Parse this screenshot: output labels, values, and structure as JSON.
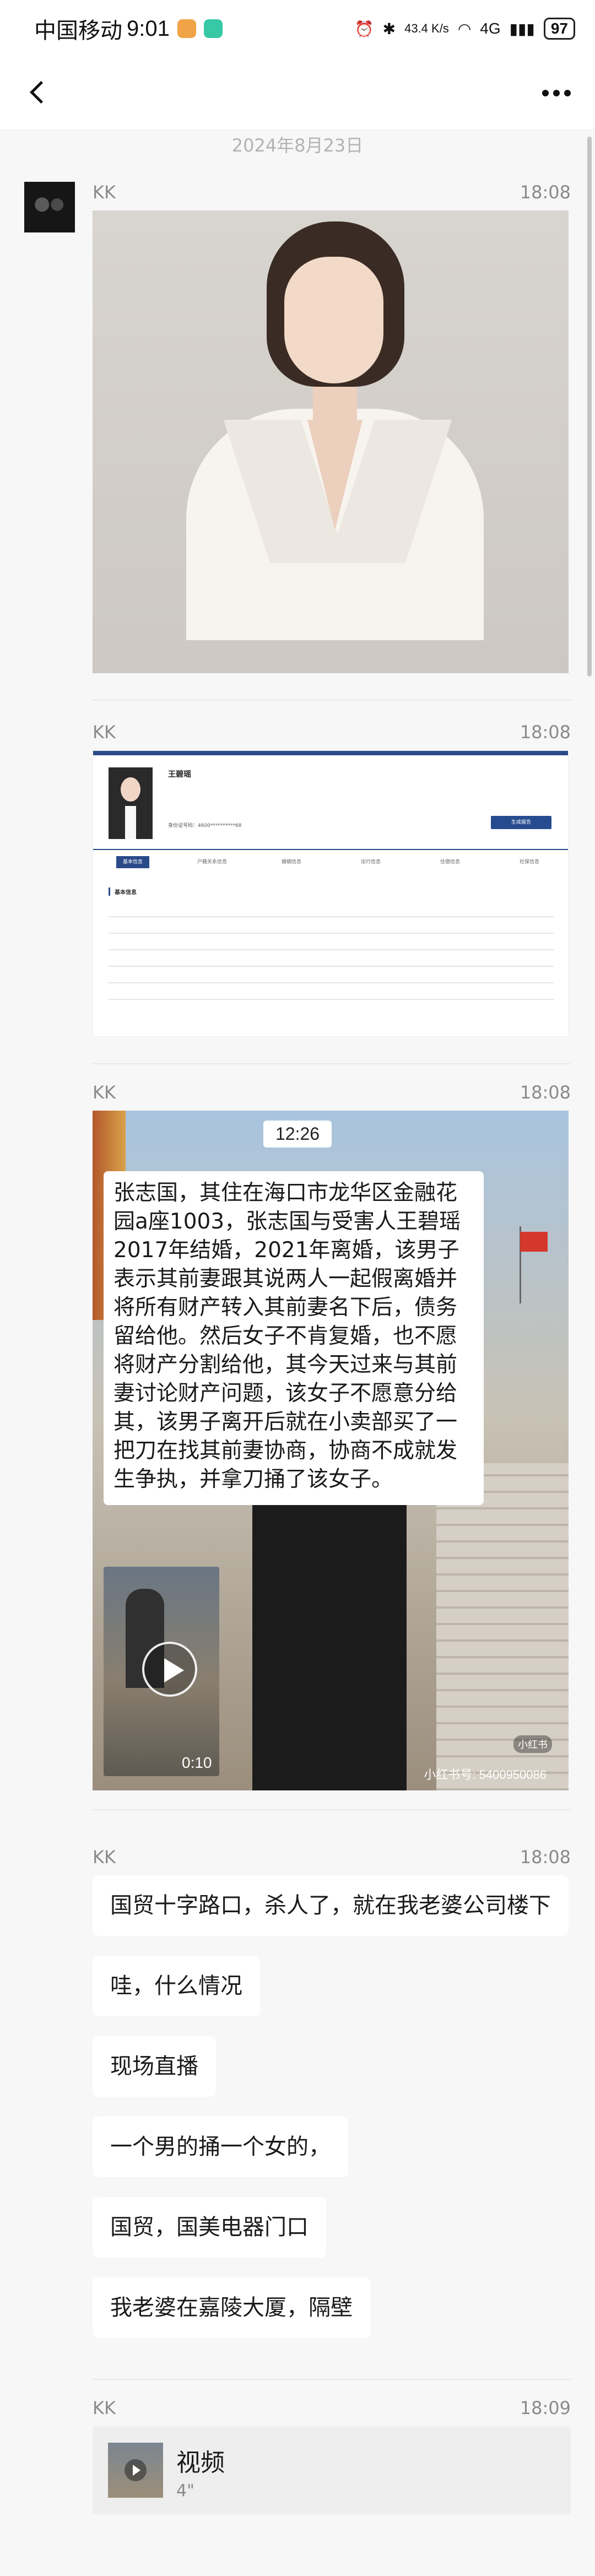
{
  "status_bar": {
    "carrier": "中国移动",
    "time": "9:01",
    "network_speed": "43.4 K/s",
    "network": "4G",
    "battery": "97"
  },
  "nav": {
    "back_icon": "chevron-left-icon",
    "more_icon": "more-dots-icon"
  },
  "chat": {
    "date": "2024年8月23日",
    "messages": [
      {
        "sender": "KK",
        "time": "18:08",
        "type": "image",
        "image_desc": "portrait photo"
      },
      {
        "sender": "KK",
        "time": "18:08",
        "type": "image",
        "document": {
          "name": "王碧瑶",
          "id_label": "身份证号码：4600**********68",
          "button": "生成报告",
          "tabs": [
            "基本信息",
            "户籍关系信息",
            "婚姻信息",
            "出行信息",
            "住宿信息",
            "社保信息"
          ],
          "section": "基本信息"
        }
      },
      {
        "sender": "KK",
        "time": "18:08",
        "type": "video",
        "video": {
          "time_overlay": "12:26",
          "text": "张志国，其住在海口市龙华区金融花园a座1003，张志国与受害人王碧瑶2017年结婚，2021年离婚，该男子表示其前妻跟其说两人一起假离婚并将所有财产转入其前妻名下后，债务留给他。然后女子不肯复婚，也不愿将财产分割给他，其今天过来与其前妻讨论财产问题，该女子不愿意分给其，该男子离开后就在小卖部买了一把刀在找其前妻协商，协商不成就发生争执，并拿刀捅了该女子。",
          "duration": "0:10",
          "logo": "小红书",
          "watermark": "小红书号: 5400950086"
        }
      },
      {
        "sender": "KK",
        "time": "18:08",
        "type": "text_group",
        "texts": [
          "国贸十字路口，杀人了，就在我老婆公司楼下",
          "哇，什么情况",
          "现场直播",
          "一个男的捅一个女的，",
          "国贸，国美电器门口",
          "我老婆在嘉陵大厦，隔壁"
        ]
      },
      {
        "sender": "KK",
        "time": "18:09",
        "type": "video_file",
        "title": "视频",
        "duration": "4\""
      }
    ]
  }
}
